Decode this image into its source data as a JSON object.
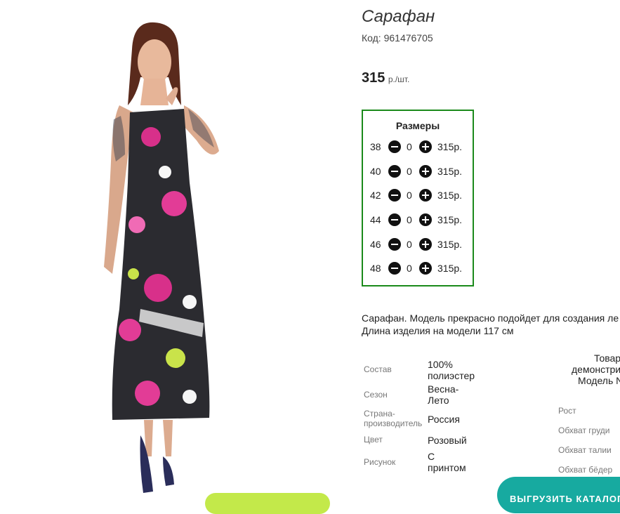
{
  "product": {
    "title": "Сарафан",
    "code": "Код: 961476705",
    "price": "315",
    "price_unit": "р./шт."
  },
  "sizes": {
    "header": "Размеры",
    "rows": [
      {
        "size": "38",
        "qty": "0",
        "price": "315р."
      },
      {
        "size": "40",
        "qty": "0",
        "price": "315р."
      },
      {
        "size": "42",
        "qty": "0",
        "price": "315р."
      },
      {
        "size": "44",
        "qty": "0",
        "price": "315р."
      },
      {
        "size": "46",
        "qty": "0",
        "price": "315р."
      },
      {
        "size": "48",
        "qty": "0",
        "price": "315р."
      }
    ]
  },
  "description": {
    "line1": "Сарафан. Модель прекрасно подойдет для создания ле",
    "line2": "Длина изделия на модели 117 см"
  },
  "specs": [
    {
      "label": "Состав",
      "value1": "100%",
      "value2": "полиэстер"
    },
    {
      "label": "Сезон",
      "value1": "Весна-",
      "value2": "Лето"
    },
    {
      "label1": "Страна-",
      "label2": "производитель",
      "value": "Россия"
    },
    {
      "label": "Цвет",
      "value": "Розовый"
    },
    {
      "label": "Рисунок",
      "value1": "С",
      "value2": "принтом"
    }
  ],
  "model_info": {
    "line1": "Товар",
    "line2": "демонстри",
    "line3": "Модель N"
  },
  "measurements": [
    "Рост",
    "Обхват груди",
    "Обхват талии",
    "Обхват бёдер"
  ],
  "export_button": "ВЫГРУЗИТЬ КАТАЛОГ"
}
